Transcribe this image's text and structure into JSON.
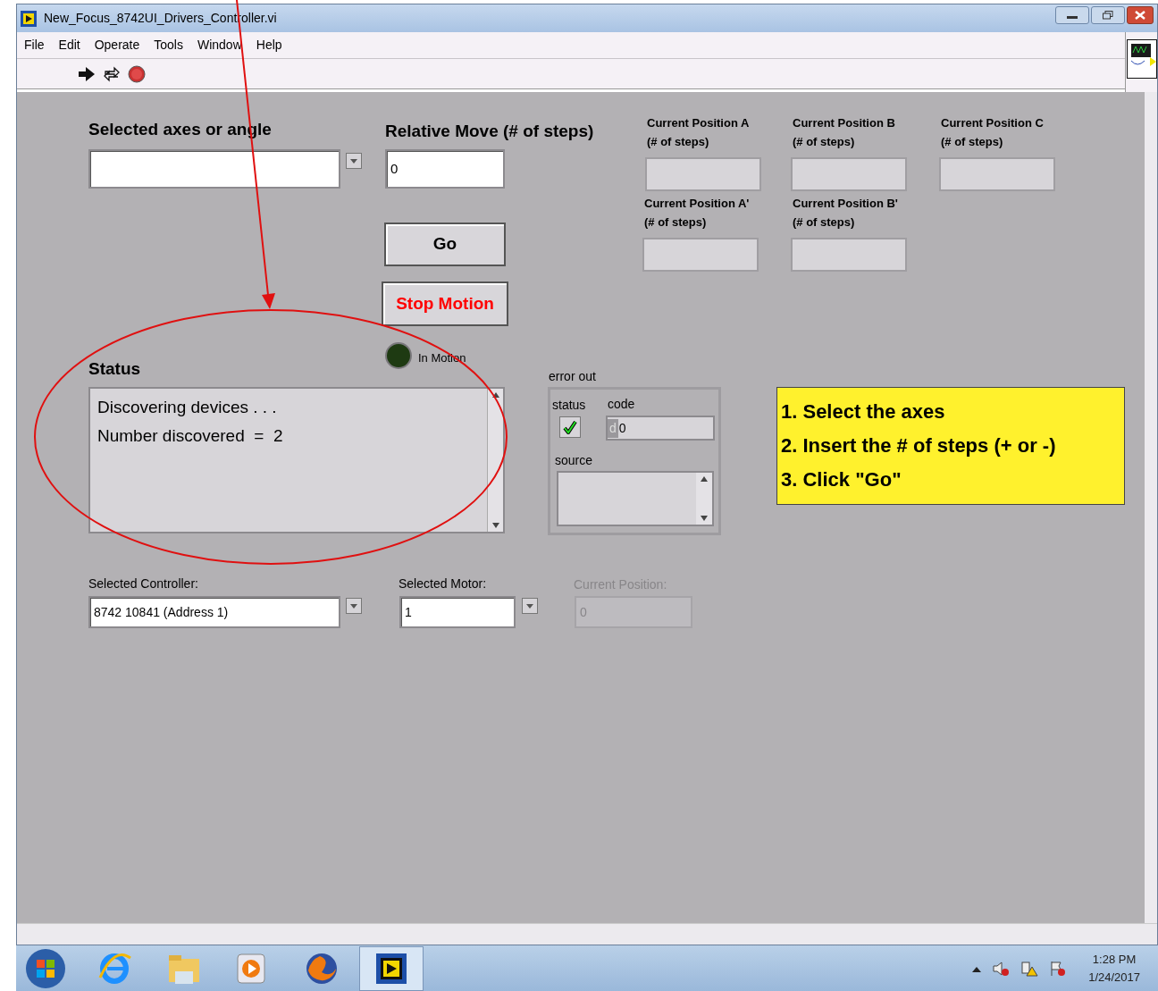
{
  "window": {
    "title": "New_Focus_8742UI_Drivers_Controller.vi"
  },
  "menu": [
    "File",
    "Edit",
    "Operate",
    "Tools",
    "Window",
    "Help"
  ],
  "panel": {
    "axes": {
      "label": "Selected axes or angle"
    },
    "relative_move": {
      "label": "Relative Move (# of steps)",
      "value": "0"
    },
    "go_button": "Go",
    "stop_button": "Stop Motion",
    "in_motion": {
      "label": "In Motion",
      "on": false
    },
    "positions": [
      {
        "label": "Current Position A",
        "unit": "(# of steps)"
      },
      {
        "label": "Current Position B",
        "unit": "(# of steps)"
      },
      {
        "label": "Current Position C",
        "unit": "(# of steps)"
      },
      {
        "label": "Current Position A'",
        "unit": "(# of steps)"
      },
      {
        "label": "Current Position B'",
        "unit": "(# of steps)"
      }
    ],
    "status": {
      "label": "Status",
      "lines": [
        "Discovering devices . . .",
        "Number discovered  =  2"
      ]
    },
    "error_out": {
      "label": "error out",
      "status_label": "status",
      "checked": true,
      "code_label": "code",
      "code_prefix": "d",
      "code": "0",
      "source_label": "source"
    },
    "instructions": [
      "1. Select the axes",
      "2. Insert the # of steps (+ or -)",
      "3. Click \"Go\""
    ],
    "controller": {
      "label": "Selected Controller:",
      "value": "8742 10841 (Address 1)"
    },
    "motor": {
      "label": "Selected Motor:",
      "value": "1"
    },
    "current_position": {
      "label": "Current Position:",
      "value": "0",
      "disabled": true
    }
  },
  "taskbar": {
    "time": "1:28 PM",
    "date": "1/24/2017"
  }
}
